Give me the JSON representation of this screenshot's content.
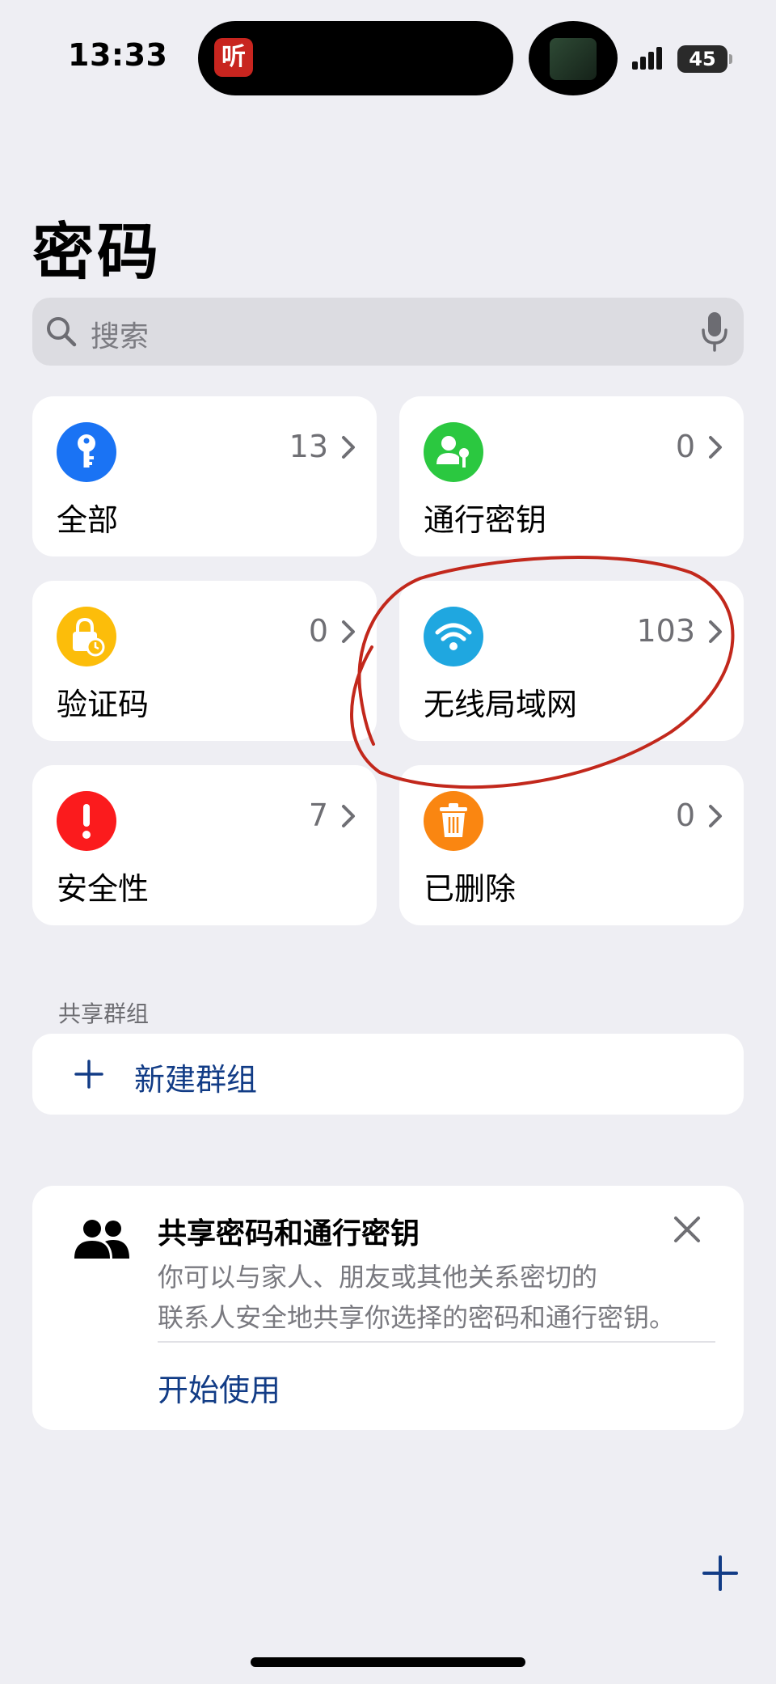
{
  "status_bar": {
    "time": "13:33",
    "island_app_glyph": "听",
    "battery": "45"
  },
  "title": "密码",
  "search": {
    "placeholder": "搜索"
  },
  "categories": [
    {
      "label": "全部",
      "count": "13",
      "icon": "key-icon",
      "color": "#1a73f4"
    },
    {
      "label": "通行密钥",
      "count": "0",
      "icon": "person-key-icon",
      "color": "#2bc840"
    },
    {
      "label": "验证码",
      "count": "0",
      "icon": "lock-clock-icon",
      "color": "#fcbd0a"
    },
    {
      "label": "无线局域网",
      "count": "103",
      "icon": "wifi-icon",
      "color": "#1fa7e0"
    },
    {
      "label": "安全性",
      "count": "7",
      "icon": "exclamation-icon",
      "color": "#fb1b1d"
    },
    {
      "label": "已删除",
      "count": "0",
      "icon": "trash-icon",
      "color": "#fa8611"
    }
  ],
  "shared_groups": {
    "section_label": "共享群组",
    "new_group_label": "新建群组"
  },
  "share_card": {
    "title": "共享密码和通行密钥",
    "description_line1": "你可以与家人、朋友或其他关系密切的",
    "description_line2": "联系人安全地共享你选择的密码和通行密钥。",
    "action_label": "开始使用"
  },
  "colors": {
    "background": "#eeeef3",
    "link": "#123c86",
    "annotation": "#c2281c"
  }
}
